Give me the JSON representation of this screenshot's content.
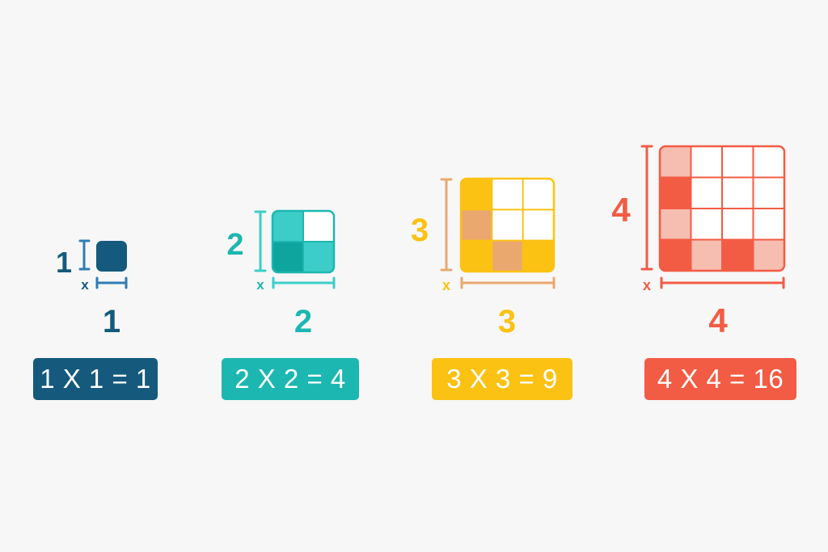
{
  "squares": [
    {
      "id": "1",
      "side_label": "1",
      "x_label": "x",
      "bottom_label": "1",
      "equation": "1 X 1 = 1",
      "color_main": "#155a7d",
      "color_light": "#155a7d",
      "color_mid": "#155a7d",
      "cells": [
        [
          "main"
        ]
      ]
    },
    {
      "id": "2",
      "side_label": "2",
      "x_label": "x",
      "bottom_label": "2",
      "equation": "2 X 2 = 4",
      "color_main": "#1cb7b0",
      "color_light": "#3dcdc8",
      "color_mid": "#0fa59f",
      "cells": [
        [
          "light",
          "empty"
        ],
        [
          "mid",
          "light"
        ]
      ]
    },
    {
      "id": "3",
      "side_label": "3",
      "x_label": "x",
      "bottom_label": "3",
      "equation": "3 X 3 = 9",
      "color_main": "#fbc214",
      "color_light": "#fbc214",
      "color_mid": "#eaa86e",
      "cells": [
        [
          "main",
          "empty",
          "empty"
        ],
        [
          "mid",
          "empty",
          "empty"
        ],
        [
          "main",
          "mid",
          "main"
        ]
      ]
    },
    {
      "id": "4",
      "side_label": "4",
      "x_label": "x",
      "bottom_label": "4",
      "equation": "4 X 4 = 16",
      "color_main": "#f25c44",
      "color_light": "#f6bdb1",
      "color_mid": "#f25c44",
      "cells": [
        [
          "light",
          "empty",
          "empty",
          "empty"
        ],
        [
          "main",
          "empty",
          "empty",
          "empty"
        ],
        [
          "light",
          "empty",
          "empty",
          "empty"
        ],
        [
          "main",
          "light",
          "main",
          "light"
        ]
      ]
    }
  ]
}
